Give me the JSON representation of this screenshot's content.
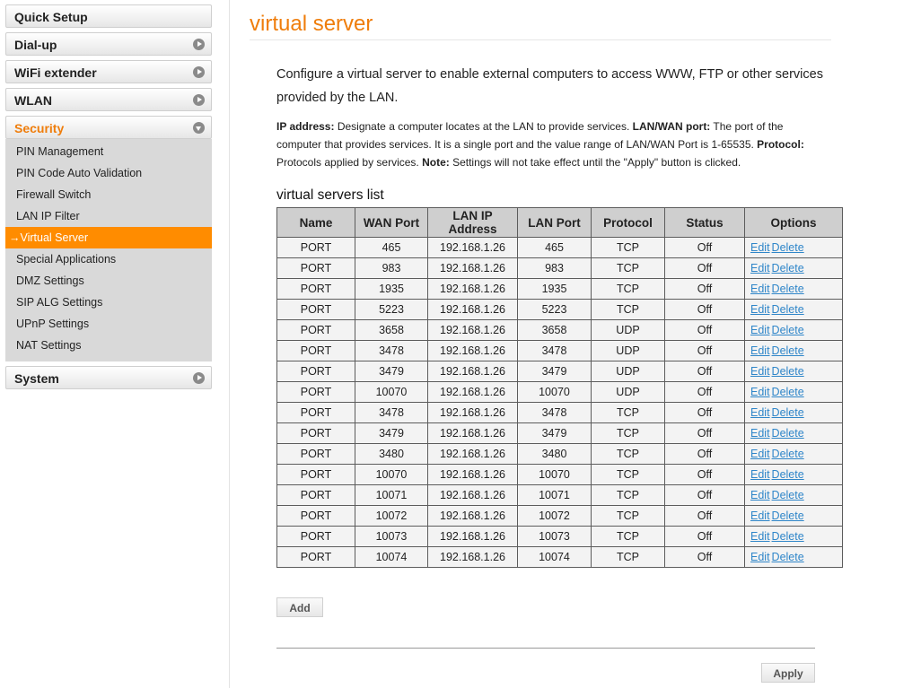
{
  "sidebar": {
    "quick_setup": "Quick Setup",
    "dialup": "Dial-up",
    "wifi_extender": "WiFi extender",
    "wlan": "WLAN",
    "security": "Security",
    "security_items": [
      "PIN Management",
      "PIN Code Auto Validation",
      "Firewall Switch",
      "LAN IP Filter",
      "Virtual Server",
      "Special Applications",
      "DMZ Settings",
      "SIP ALG Settings",
      "UPnP Settings",
      "NAT Settings"
    ],
    "active_prefix": "→",
    "system": "System"
  },
  "main": {
    "title": "virtual server",
    "intro": "Configure a virtual server to enable external computers to access WWW, FTP or other services provided by the LAN.",
    "help": {
      "ip_label": "IP address:",
      "ip_text": " Designate a computer locates at the LAN to provide services. ",
      "port_label": "LAN/WAN port:",
      "port_text": " The port of the computer that provides services. It is a single port and the value range of LAN/WAN Port is 1-65535. ",
      "protocol_label": "Protocol:",
      "protocol_text": " Protocols applied by services. ",
      "note_label": "Note:",
      "note_text": " Settings will not take effect until the \"Apply\" button is clicked."
    },
    "list_title": "virtual servers list",
    "columns": [
      "Name",
      "WAN Port",
      "LAN IP Address",
      "LAN Port",
      "Protocol",
      "Status",
      "Options"
    ],
    "edit_label": "Edit",
    "delete_label": "Delete",
    "rows": [
      [
        "PORT",
        "465",
        "192.168.1.26",
        "465",
        "TCP",
        "Off"
      ],
      [
        "PORT",
        "983",
        "192.168.1.26",
        "983",
        "TCP",
        "Off"
      ],
      [
        "PORT",
        "1935",
        "192.168.1.26",
        "1935",
        "TCP",
        "Off"
      ],
      [
        "PORT",
        "5223",
        "192.168.1.26",
        "5223",
        "TCP",
        "Off"
      ],
      [
        "PORT",
        "3658",
        "192.168.1.26",
        "3658",
        "UDP",
        "Off"
      ],
      [
        "PORT",
        "3478",
        "192.168.1.26",
        "3478",
        "UDP",
        "Off"
      ],
      [
        "PORT",
        "3479",
        "192.168.1.26",
        "3479",
        "UDP",
        "Off"
      ],
      [
        "PORT",
        "10070",
        "192.168.1.26",
        "10070",
        "UDP",
        "Off"
      ],
      [
        "PORT",
        "3478",
        "192.168.1.26",
        "3478",
        "TCP",
        "Off"
      ],
      [
        "PORT",
        "3479",
        "192.168.1.26",
        "3479",
        "TCP",
        "Off"
      ],
      [
        "PORT",
        "3480",
        "192.168.1.26",
        "3480",
        "TCP",
        "Off"
      ],
      [
        "PORT",
        "10070",
        "192.168.1.26",
        "10070",
        "TCP",
        "Off"
      ],
      [
        "PORT",
        "10071",
        "192.168.1.26",
        "10071",
        "TCP",
        "Off"
      ],
      [
        "PORT",
        "10072",
        "192.168.1.26",
        "10072",
        "TCP",
        "Off"
      ],
      [
        "PORT",
        "10073",
        "192.168.1.26",
        "10073",
        "TCP",
        "Off"
      ],
      [
        "PORT",
        "10074",
        "192.168.1.26",
        "10074",
        "TCP",
        "Off"
      ]
    ],
    "add_label": "Add",
    "apply_label": "Apply"
  },
  "colors": {
    "accent": "#ef7d0b",
    "active_bg": "#ff8c00",
    "link": "#2f86c9"
  }
}
